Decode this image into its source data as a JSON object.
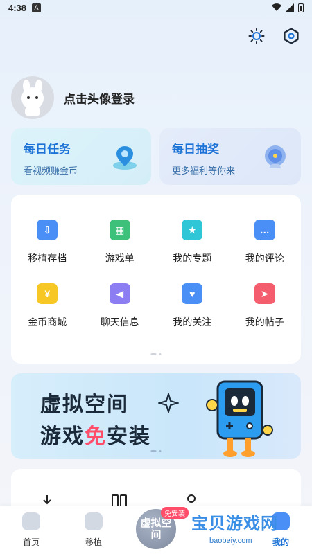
{
  "status": {
    "time": "4:38",
    "app_badge": "A"
  },
  "profile": {
    "login_text": "点击头像登录"
  },
  "daily_task": {
    "title": "每日任务",
    "subtitle": "看视频赚金币"
  },
  "daily_lottery": {
    "title": "每日抽奖",
    "subtitle": "更多福利等你来"
  },
  "grid": {
    "items": [
      {
        "label": "移植存档",
        "icon": "save-download-icon",
        "color": "#4a8ff5",
        "glyph": "⇩"
      },
      {
        "label": "游戏单",
        "icon": "game-list-icon",
        "color": "#3cc07a",
        "glyph": "▦"
      },
      {
        "label": "我的专题",
        "icon": "topic-icon",
        "color": "#2fc7d8",
        "glyph": "★"
      },
      {
        "label": "我的评论",
        "icon": "comment-icon",
        "color": "#4a8ff5",
        "glyph": "…"
      },
      {
        "label": "金币商城",
        "icon": "coin-shop-icon",
        "color": "#f7c825",
        "glyph": "¥"
      },
      {
        "label": "聊天信息",
        "icon": "chat-icon",
        "color": "#8d7df2",
        "glyph": "◀"
      },
      {
        "label": "我的关注",
        "icon": "follow-icon",
        "color": "#4a8ff5",
        "glyph": "♥"
      },
      {
        "label": "我的帖子",
        "icon": "post-icon",
        "color": "#f35d6d",
        "glyph": "➤"
      }
    ]
  },
  "banner": {
    "line1": "虚拟空间",
    "line2_a": "游戏",
    "line2_hl": "免",
    "line2_b": "安装"
  },
  "center_button": {
    "label": "虚拟空间",
    "badge": "免安装"
  },
  "bottom_nav": {
    "home": "首页",
    "port": "移植",
    "mine": "我的"
  },
  "watermark": {
    "title": "宝贝游戏网",
    "url": "baobeiy.com"
  },
  "colors": {
    "accent": "#1e73d6",
    "highlight": "#ff4d6a"
  }
}
